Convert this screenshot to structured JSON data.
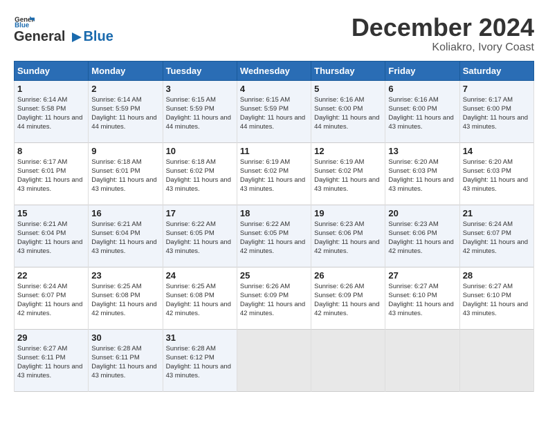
{
  "logo": {
    "part1": "General",
    "part2": "Blue"
  },
  "title": "December 2024",
  "location": "Koliakro, Ivory Coast",
  "days_of_week": [
    "Sunday",
    "Monday",
    "Tuesday",
    "Wednesday",
    "Thursday",
    "Friday",
    "Saturday"
  ],
  "weeks": [
    [
      {
        "day": "1",
        "sunrise": "6:14 AM",
        "sunset": "5:58 PM",
        "daylight": "11 hours and 44 minutes."
      },
      {
        "day": "2",
        "sunrise": "6:14 AM",
        "sunset": "5:59 PM",
        "daylight": "11 hours and 44 minutes."
      },
      {
        "day": "3",
        "sunrise": "6:15 AM",
        "sunset": "5:59 PM",
        "daylight": "11 hours and 44 minutes."
      },
      {
        "day": "4",
        "sunrise": "6:15 AM",
        "sunset": "5:59 PM",
        "daylight": "11 hours and 44 minutes."
      },
      {
        "day": "5",
        "sunrise": "6:16 AM",
        "sunset": "6:00 PM",
        "daylight": "11 hours and 44 minutes."
      },
      {
        "day": "6",
        "sunrise": "6:16 AM",
        "sunset": "6:00 PM",
        "daylight": "11 hours and 43 minutes."
      },
      {
        "day": "7",
        "sunrise": "6:17 AM",
        "sunset": "6:00 PM",
        "daylight": "11 hours and 43 minutes."
      }
    ],
    [
      {
        "day": "8",
        "sunrise": "6:17 AM",
        "sunset": "6:01 PM",
        "daylight": "11 hours and 43 minutes."
      },
      {
        "day": "9",
        "sunrise": "6:18 AM",
        "sunset": "6:01 PM",
        "daylight": "11 hours and 43 minutes."
      },
      {
        "day": "10",
        "sunrise": "6:18 AM",
        "sunset": "6:02 PM",
        "daylight": "11 hours and 43 minutes."
      },
      {
        "day": "11",
        "sunrise": "6:19 AM",
        "sunset": "6:02 PM",
        "daylight": "11 hours and 43 minutes."
      },
      {
        "day": "12",
        "sunrise": "6:19 AM",
        "sunset": "6:02 PM",
        "daylight": "11 hours and 43 minutes."
      },
      {
        "day": "13",
        "sunrise": "6:20 AM",
        "sunset": "6:03 PM",
        "daylight": "11 hours and 43 minutes."
      },
      {
        "day": "14",
        "sunrise": "6:20 AM",
        "sunset": "6:03 PM",
        "daylight": "11 hours and 43 minutes."
      }
    ],
    [
      {
        "day": "15",
        "sunrise": "6:21 AM",
        "sunset": "6:04 PM",
        "daylight": "11 hours and 43 minutes."
      },
      {
        "day": "16",
        "sunrise": "6:21 AM",
        "sunset": "6:04 PM",
        "daylight": "11 hours and 43 minutes."
      },
      {
        "day": "17",
        "sunrise": "6:22 AM",
        "sunset": "6:05 PM",
        "daylight": "11 hours and 43 minutes."
      },
      {
        "day": "18",
        "sunrise": "6:22 AM",
        "sunset": "6:05 PM",
        "daylight": "11 hours and 42 minutes."
      },
      {
        "day": "19",
        "sunrise": "6:23 AM",
        "sunset": "6:06 PM",
        "daylight": "11 hours and 42 minutes."
      },
      {
        "day": "20",
        "sunrise": "6:23 AM",
        "sunset": "6:06 PM",
        "daylight": "11 hours and 42 minutes."
      },
      {
        "day": "21",
        "sunrise": "6:24 AM",
        "sunset": "6:07 PM",
        "daylight": "11 hours and 42 minutes."
      }
    ],
    [
      {
        "day": "22",
        "sunrise": "6:24 AM",
        "sunset": "6:07 PM",
        "daylight": "11 hours and 42 minutes."
      },
      {
        "day": "23",
        "sunrise": "6:25 AM",
        "sunset": "6:08 PM",
        "daylight": "11 hours and 42 minutes."
      },
      {
        "day": "24",
        "sunrise": "6:25 AM",
        "sunset": "6:08 PM",
        "daylight": "11 hours and 42 minutes."
      },
      {
        "day": "25",
        "sunrise": "6:26 AM",
        "sunset": "6:09 PM",
        "daylight": "11 hours and 42 minutes."
      },
      {
        "day": "26",
        "sunrise": "6:26 AM",
        "sunset": "6:09 PM",
        "daylight": "11 hours and 42 minutes."
      },
      {
        "day": "27",
        "sunrise": "6:27 AM",
        "sunset": "6:10 PM",
        "daylight": "11 hours and 43 minutes."
      },
      {
        "day": "28",
        "sunrise": "6:27 AM",
        "sunset": "6:10 PM",
        "daylight": "11 hours and 43 minutes."
      }
    ],
    [
      {
        "day": "29",
        "sunrise": "6:27 AM",
        "sunset": "6:11 PM",
        "daylight": "11 hours and 43 minutes."
      },
      {
        "day": "30",
        "sunrise": "6:28 AM",
        "sunset": "6:11 PM",
        "daylight": "11 hours and 43 minutes."
      },
      {
        "day": "31",
        "sunrise": "6:28 AM",
        "sunset": "6:12 PM",
        "daylight": "11 hours and 43 minutes."
      },
      null,
      null,
      null,
      null
    ]
  ],
  "labels": {
    "sunrise": "Sunrise:",
    "sunset": "Sunset:",
    "daylight": "Daylight:"
  }
}
